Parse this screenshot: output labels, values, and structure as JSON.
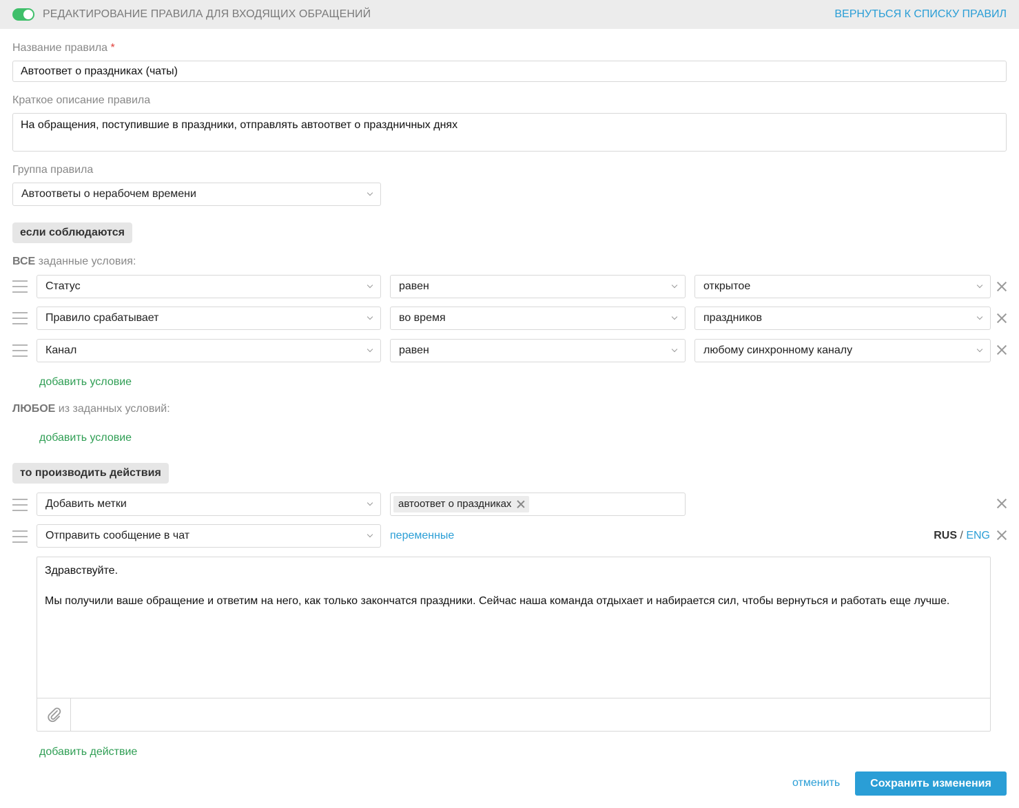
{
  "header": {
    "title": "РЕДАКТИРОВАНИЕ ПРАВИЛА ДЛЯ ВХОДЯЩИХ ОБРАЩЕНИЙ",
    "back_link": "ВЕРНУТЬСЯ К СПИСКУ ПРАВИЛ",
    "toggle_on": true
  },
  "form": {
    "name_label": "Название правила",
    "required_mark": "*",
    "name_value": "Автоответ о праздниках (чаты)",
    "desc_label": "Краткое описание правила",
    "desc_value": "На обращения, поступившие в праздники, отправлять автоответ о праздничных днях",
    "group_label": "Группа правила",
    "group_value": "Автоответы о нерабочем времени"
  },
  "conditions": {
    "if_label": "если соблюдаются",
    "all_strong": "ВСЕ",
    "all_rest": " заданные условия:",
    "rows": [
      {
        "field": "Статус",
        "operator": "равен",
        "value": "открытое"
      },
      {
        "field": "Правило срабатывает",
        "operator": "во время",
        "value": "праздников"
      },
      {
        "field": "Канал",
        "operator": "равен",
        "value": "любому синхронному каналу"
      }
    ],
    "add_condition": "добавить условие",
    "any_strong": "ЛЮБОЕ",
    "any_rest": " из заданных условий:",
    "add_condition_any": "добавить условие"
  },
  "actions": {
    "then_label": "то производить действия",
    "rows": [
      {
        "action": "Добавить метки",
        "tag": "автоответ о праздниках"
      },
      {
        "action": "Отправить сообщение в чат",
        "variables_link": "переменные"
      }
    ],
    "lang_rus": "RUS",
    "lang_sep": " / ",
    "lang_eng": "ENG",
    "message": "Здравствуйте.\n\nМы получили ваше обращение и ответим на него, как только закончатся праздники. Сейчас наша команда отдыхает и набирается сил, чтобы вернуться и работать еще лучше.",
    "add_action": "добавить действие"
  },
  "footer": {
    "cancel": "отменить",
    "save": "Сохранить изменения"
  },
  "colors": {
    "accent_blue": "#2a9ed6",
    "accent_green": "#2f9e54",
    "toggle_green": "#3fbf6a",
    "required_red": "#e0403a"
  }
}
